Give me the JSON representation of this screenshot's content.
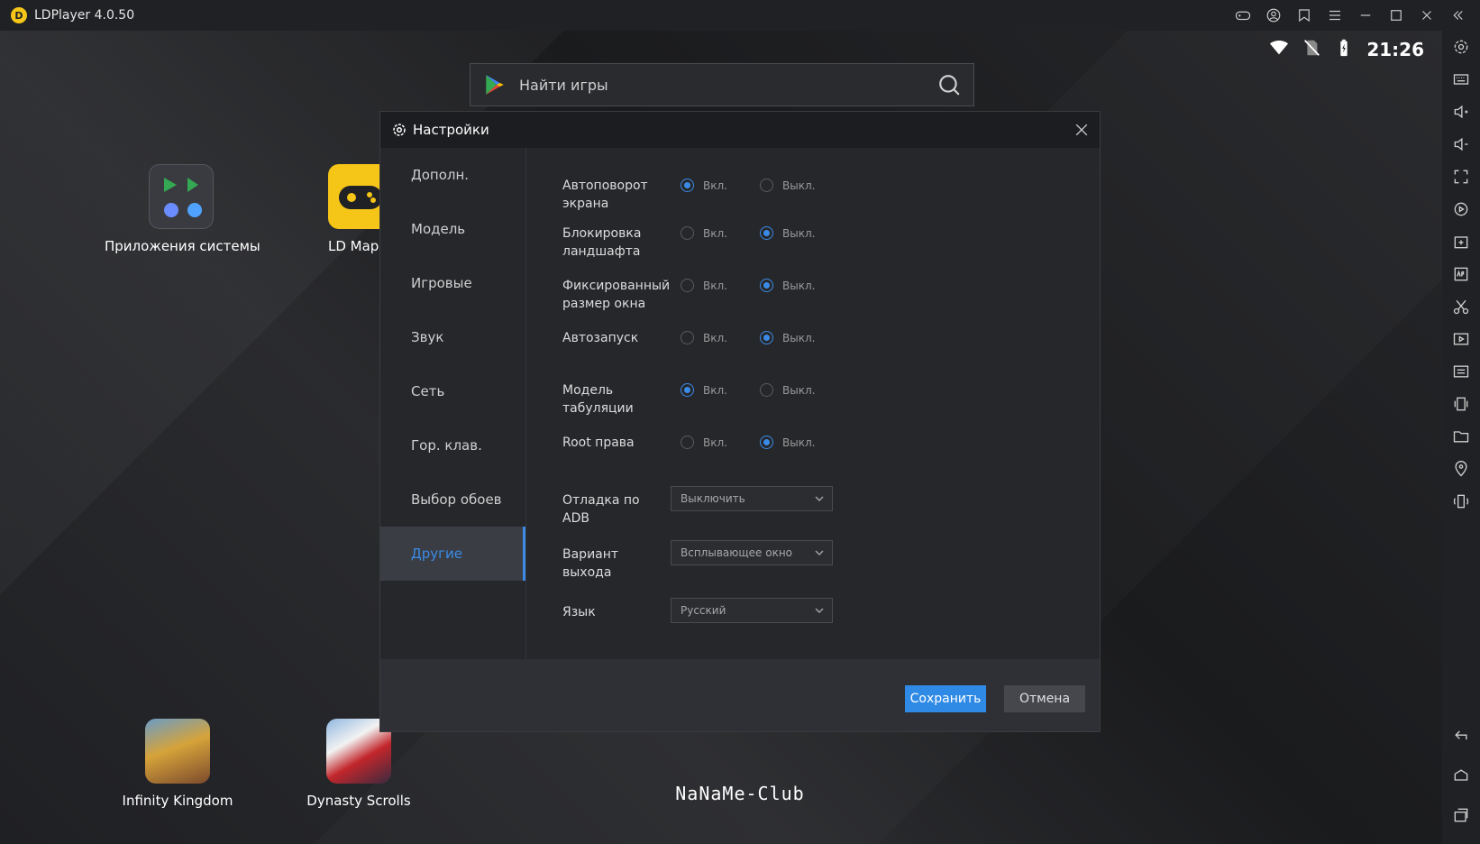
{
  "window": {
    "title": "LDPlayer 4.0.50",
    "logo_letter": "D"
  },
  "status_bar": {
    "time": "21:26"
  },
  "search": {
    "placeholder": "Найти игры"
  },
  "desktop_apps": [
    {
      "label": "Приложения системы"
    },
    {
      "label": "LD Марк"
    },
    {
      "label": "Infinity Kingdom"
    },
    {
      "label": "Dynasty Scrolls"
    }
  ],
  "watermark": "NaNaMe-Club",
  "settings": {
    "title": "Настройки",
    "nav": [
      "Дополн.",
      "Модель",
      "Игровые",
      "Звук",
      "Сеть",
      "Гор. клав.",
      "Выбор обоев",
      "Другие"
    ],
    "active_nav": "Другие",
    "on_label": "Вкл.",
    "off_label": "Выкл.",
    "options": [
      {
        "label": "Автоповорот экрана",
        "value": "on"
      },
      {
        "label": "Блокировка ландшафта",
        "value": "off"
      },
      {
        "label": "Фиксированный размер окна",
        "value": "off"
      },
      {
        "label": "Автозапуск",
        "value": "off"
      },
      {
        "label": "Модель табуляции",
        "value": "on"
      },
      {
        "label": "Root права",
        "value": "off"
      }
    ],
    "dropdowns": [
      {
        "label": "Отладка по ADB",
        "value": "Выключить"
      },
      {
        "label": "Вариант выхода",
        "value": "Всплывающее окно"
      },
      {
        "label": "Язык",
        "value": "Русский"
      }
    ],
    "save_label": "Сохранить",
    "cancel_label": "Отмена"
  },
  "colors": {
    "accent": "#3b8be6",
    "save_button": "#2f8ae6",
    "background": "#1b1c1e"
  }
}
